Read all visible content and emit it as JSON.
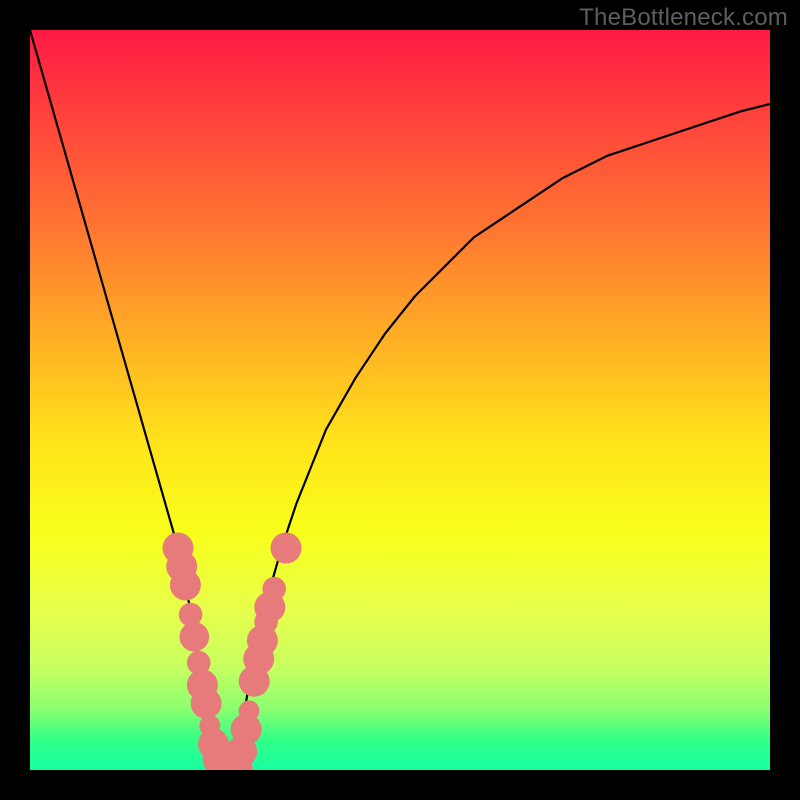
{
  "watermark": "TheBottleneck.com",
  "chart_data": {
    "type": "line",
    "title": "",
    "xlabel": "",
    "ylabel": "",
    "xlim": [
      0,
      100
    ],
    "ylim": [
      0,
      100
    ],
    "curve": {
      "name": "bottleneck-curve",
      "x": [
        0,
        2,
        4,
        6,
        8,
        10,
        12,
        14,
        16,
        18,
        20,
        22,
        23,
        24,
        25,
        26,
        27,
        28,
        29,
        30,
        32,
        34,
        36,
        38,
        40,
        44,
        48,
        52,
        56,
        60,
        66,
        72,
        78,
        84,
        90,
        96,
        100
      ],
      "y": [
        100,
        93,
        86,
        79,
        72,
        65,
        58,
        51,
        44,
        37,
        30,
        20,
        14,
        8,
        3,
        0,
        0,
        3,
        8,
        14,
        23,
        30,
        36,
        41,
        46,
        53,
        59,
        64,
        68,
        72,
        76,
        80,
        83,
        85,
        87,
        89,
        90
      ]
    },
    "markers_left": {
      "name": "left-cluster",
      "points": [
        {
          "x": 20.0,
          "y": 30.0,
          "r": 2.1
        },
        {
          "x": 20.5,
          "y": 27.5,
          "r": 2.1
        },
        {
          "x": 21.0,
          "y": 25.0,
          "r": 2.1
        },
        {
          "x": 21.7,
          "y": 21.0,
          "r": 1.6
        },
        {
          "x": 22.2,
          "y": 18.0,
          "r": 2.0
        },
        {
          "x": 22.8,
          "y": 14.5,
          "r": 1.6
        },
        {
          "x": 23.3,
          "y": 11.5,
          "r": 2.1
        },
        {
          "x": 23.8,
          "y": 9.0,
          "r": 2.1
        },
        {
          "x": 24.3,
          "y": 6.0,
          "r": 1.4
        },
        {
          "x": 24.8,
          "y": 3.5,
          "r": 2.1
        },
        {
          "x": 25.4,
          "y": 1.5,
          "r": 2.1
        }
      ]
    },
    "markers_bottom": {
      "name": "bottom-cluster",
      "points": [
        {
          "x": 26.0,
          "y": 0.2,
          "r": 2.1
        },
        {
          "x": 26.6,
          "y": 0.0,
          "r": 2.1
        },
        {
          "x": 27.3,
          "y": 0.0,
          "r": 2.1
        },
        {
          "x": 28.0,
          "y": 0.2,
          "r": 2.1
        }
      ]
    },
    "markers_right": {
      "name": "right-cluster",
      "points": [
        {
          "x": 28.6,
          "y": 2.5,
          "r": 2.1
        },
        {
          "x": 29.2,
          "y": 5.5,
          "r": 2.1
        },
        {
          "x": 29.6,
          "y": 8.0,
          "r": 1.4
        },
        {
          "x": 30.3,
          "y": 12.0,
          "r": 2.1
        },
        {
          "x": 30.9,
          "y": 15.0,
          "r": 2.1
        },
        {
          "x": 31.4,
          "y": 17.5,
          "r": 2.1
        },
        {
          "x": 31.9,
          "y": 20.0,
          "r": 1.6
        },
        {
          "x": 32.4,
          "y": 22.0,
          "r": 2.1
        },
        {
          "x": 33.0,
          "y": 24.5,
          "r": 1.6
        },
        {
          "x": 34.6,
          "y": 30.0,
          "r": 2.1
        }
      ]
    }
  }
}
